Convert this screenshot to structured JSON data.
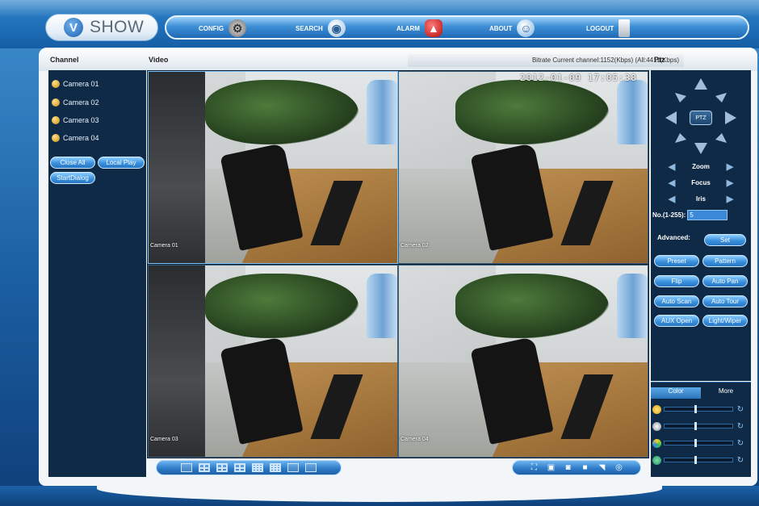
{
  "header": {
    "logo_mark": "V",
    "logo_text": "SHOW",
    "nav": [
      {
        "label": "CONFIG",
        "icon": "config-icon"
      },
      {
        "label": "SEARCH",
        "icon": "search-icon"
      },
      {
        "label": "ALARM",
        "icon": "alarm-icon"
      },
      {
        "label": "ABOUT",
        "icon": "about-icon"
      },
      {
        "label": "LOGOUT",
        "icon": "logout-icon"
      }
    ]
  },
  "panel": {
    "channel_title": "Channel",
    "video_title": "Video",
    "bitrate_text": "Bitrate Current channel:1152(Kbps) (All:4411(Kbps)",
    "ptz_title": "Ptz"
  },
  "channels": {
    "cameras": [
      "Camera 01",
      "Camera 02",
      "Camera 03",
      "Camera 04"
    ],
    "close_all": "Close All",
    "local_play": "Local Play",
    "start_dialog": "StartDialog"
  },
  "video": {
    "osd_time": "2012-01-09 17:05:38",
    "tiles": [
      {
        "label": "Camera 01"
      },
      {
        "label": "Camera 02"
      },
      {
        "label": "Camera 03"
      },
      {
        "label": "Camera 04"
      }
    ]
  },
  "ptz": {
    "center_label": "PTZ",
    "zoom": "Zoom",
    "focus": "Focus",
    "iris": "Iris",
    "step_label": "No.(1-255):",
    "step_value": "5",
    "advanced": "Advanced:",
    "buttons": [
      "Set",
      "Preset",
      "Pattern",
      "Flip",
      "Auto Pan",
      "Auto Scan",
      "Auto Tour",
      "AUX Open",
      "Light/Wiper"
    ]
  },
  "color": {
    "tab_color": "Color",
    "tab_more": "More",
    "sliders": [
      {
        "name": "brightness",
        "level": 0.45
      },
      {
        "name": "contrast",
        "level": 0.45
      },
      {
        "name": "saturation",
        "level": 0.45
      },
      {
        "name": "hue",
        "level": 0.45
      }
    ]
  },
  "colors": {
    "accent": "#3b91dd",
    "panel_dark": "#0f2a47",
    "header_blue": "#1d6db6"
  }
}
